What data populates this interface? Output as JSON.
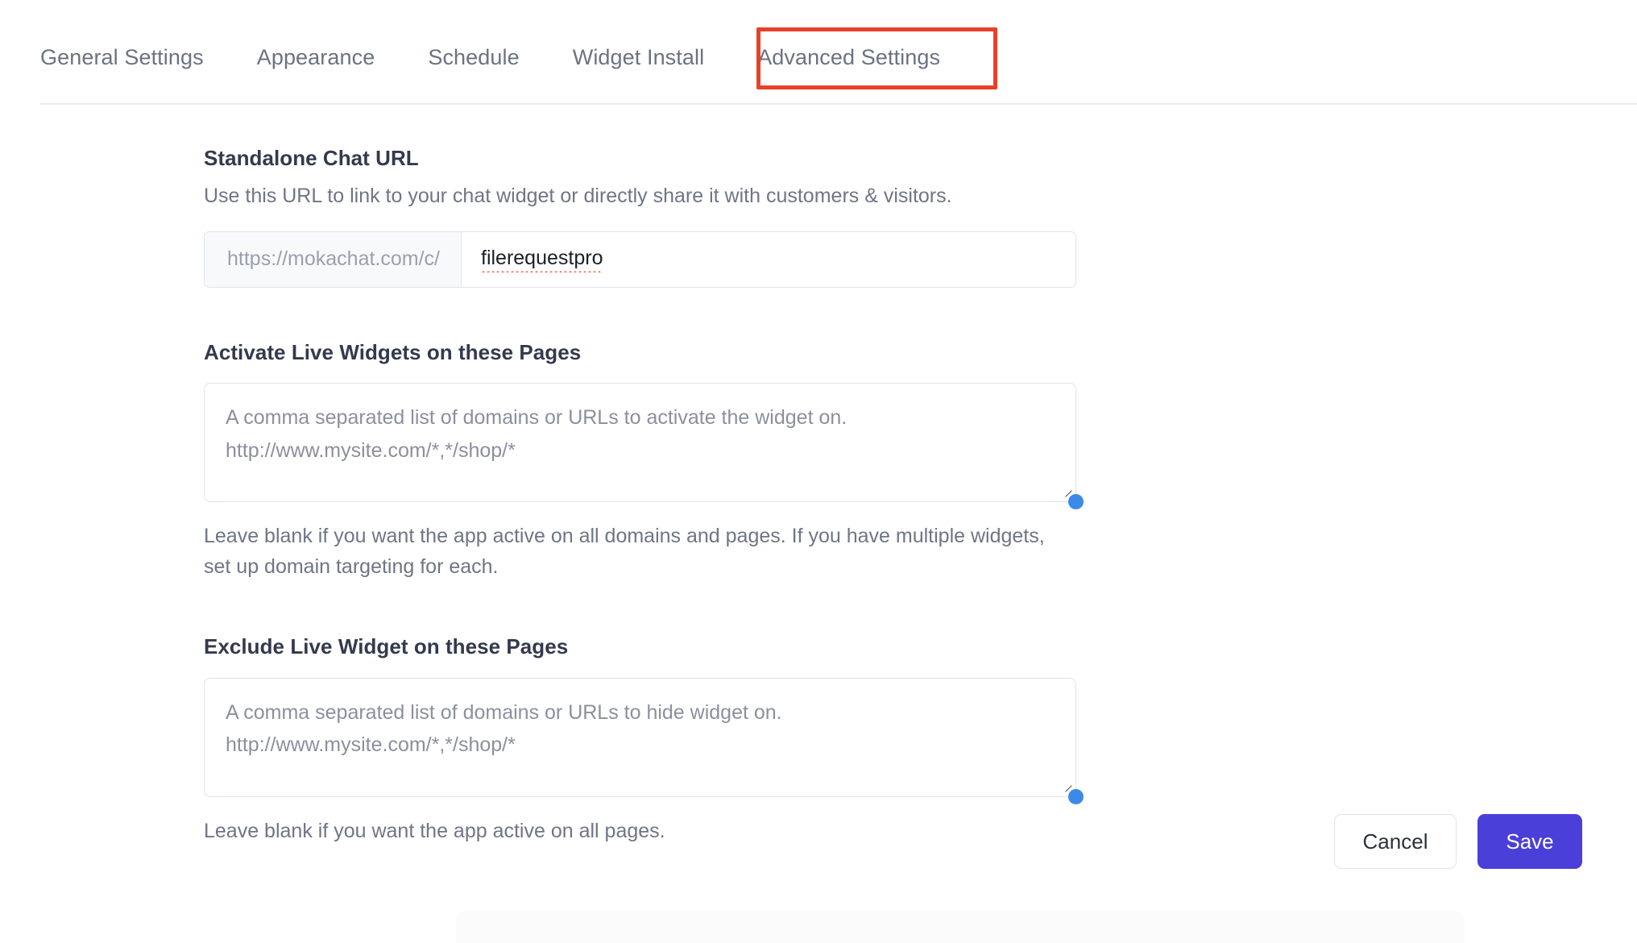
{
  "tabs": [
    {
      "label": "General Settings",
      "active": false
    },
    {
      "label": "Appearance",
      "active": false
    },
    {
      "label": "Schedule",
      "active": false
    },
    {
      "label": "Widget Install",
      "active": false
    },
    {
      "label": "Advanced Settings",
      "active": true
    }
  ],
  "annotation": {
    "target": "Advanced Settings",
    "color": "#e8412a"
  },
  "standalone_chat_url": {
    "title": "Standalone Chat URL",
    "description": "Use this URL to link to your chat widget or directly share it with customers & visitors.",
    "prefix": "https://mokachat.com/c/",
    "value": "filerequestpro",
    "placeholder": ""
  },
  "activate_pages": {
    "title": "Activate Live Widgets on these Pages",
    "placeholder": "A comma separated list of domains or URLs to activate the widget on. http://www.mysite.com/*,*/shop/*",
    "value": "",
    "helper": "Leave blank if you want the app active on all domains and pages. If you have multiple widgets, set up domain targeting for each."
  },
  "exclude_pages": {
    "title": "Exclude Live Widget on these Pages",
    "placeholder": "A comma separated list of domains or URLs to hide widget on. http://www.mysite.com/*,*/shop/*",
    "value": "",
    "helper": "Leave blank if you want the app active on all pages."
  },
  "actions": {
    "cancel_label": "Cancel",
    "save_label": "Save",
    "save_color": "#4a3fd9"
  },
  "colors": {
    "accent": "#4a3fd9",
    "annotation": "#e8412a",
    "resize_handle": "#3b8ae8",
    "text_muted": "#6f7585",
    "text_strong": "#343a4d",
    "border": "#dfe3ea"
  }
}
